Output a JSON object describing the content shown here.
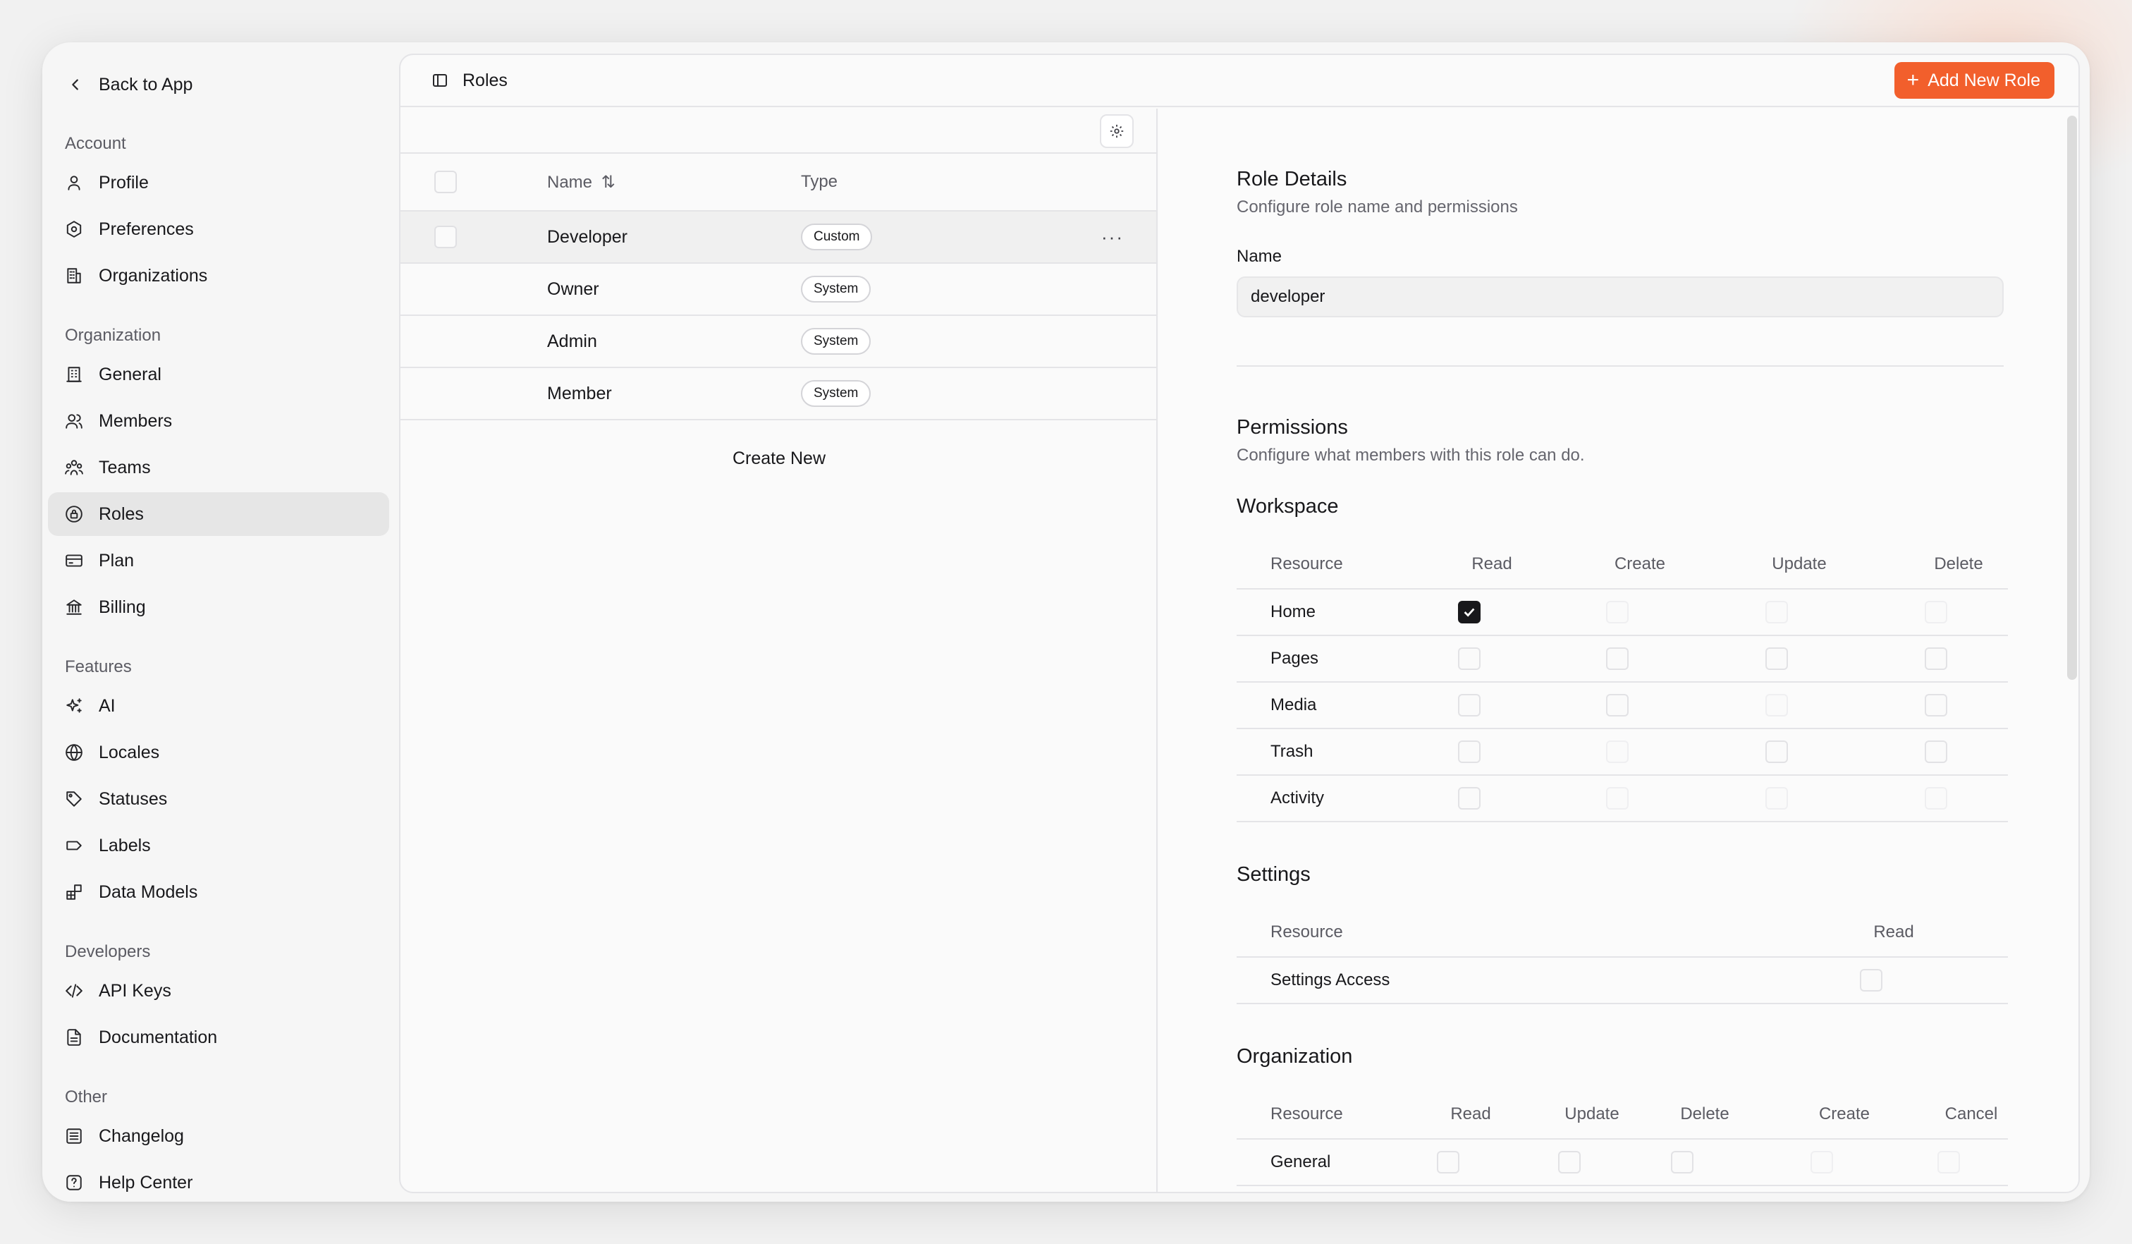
{
  "sidebar": {
    "back_label": "Back to App",
    "sections": [
      {
        "label": "Account",
        "items": [
          {
            "label": "Profile",
            "icon": "user-icon"
          },
          {
            "label": "Preferences",
            "icon": "settings-hexagon-icon"
          },
          {
            "label": "Organizations",
            "icon": "building-icon"
          }
        ]
      },
      {
        "label": "Organization",
        "items": [
          {
            "label": "General",
            "icon": "building-2-icon"
          },
          {
            "label": "Members",
            "icon": "users-icon"
          },
          {
            "label": "Teams",
            "icon": "team-icon"
          },
          {
            "label": "Roles",
            "icon": "lock-icon",
            "active": true
          },
          {
            "label": "Plan",
            "icon": "credit-card-icon"
          },
          {
            "label": "Billing",
            "icon": "bank-icon"
          }
        ]
      },
      {
        "label": "Features",
        "items": [
          {
            "label": "AI",
            "icon": "sparkles-icon"
          },
          {
            "label": "Locales",
            "icon": "globe-icon"
          },
          {
            "label": "Statuses",
            "icon": "tag-icon"
          },
          {
            "label": "Labels",
            "icon": "label-icon"
          },
          {
            "label": "Data Models",
            "icon": "blocks-icon"
          }
        ]
      },
      {
        "label": "Developers",
        "items": [
          {
            "label": "API Keys",
            "icon": "code-icon"
          },
          {
            "label": "Documentation",
            "icon": "file-icon"
          }
        ]
      },
      {
        "label": "Other",
        "items": [
          {
            "label": "Changelog",
            "icon": "list-icon"
          },
          {
            "label": "Help Center",
            "icon": "help-icon"
          }
        ]
      }
    ]
  },
  "header": {
    "title": "Roles",
    "add_button": "Add New Role"
  },
  "roles_table": {
    "columns": {
      "name": "Name",
      "type": "Type"
    },
    "rows": [
      {
        "name": "Developer",
        "type": "Custom"
      },
      {
        "name": "Owner",
        "type": "System"
      },
      {
        "name": "Admin",
        "type": "System"
      },
      {
        "name": "Member",
        "type": "System"
      }
    ],
    "create_new": "Create New"
  },
  "details": {
    "title": "Role Details",
    "subtitle": "Configure role name and permissions",
    "name_label": "Name",
    "name_value": "developer",
    "permissions_title": "Permissions",
    "permissions_subtitle": "Configure what members with this role can do.",
    "workspace": {
      "title": "Workspace",
      "resource_header": "Resource",
      "columns": [
        "Read",
        "Create",
        "Update",
        "Delete"
      ],
      "rows": [
        {
          "name": "Home",
          "checked": [
            true,
            false,
            false,
            false
          ]
        },
        {
          "name": "Pages",
          "checked": [
            false,
            false,
            false,
            false
          ]
        },
        {
          "name": "Media",
          "checked": [
            false,
            false,
            false,
            false
          ]
        },
        {
          "name": "Trash",
          "checked": [
            false,
            false,
            false,
            false
          ]
        },
        {
          "name": "Activity",
          "checked": [
            false,
            false,
            false,
            false
          ]
        }
      ]
    },
    "settings": {
      "title": "Settings",
      "resource_header": "Resource",
      "columns": [
        "Read"
      ],
      "rows": [
        {
          "name": "Settings Access",
          "checked": [
            false
          ]
        }
      ]
    },
    "organization": {
      "title": "Organization",
      "resource_header": "Resource",
      "columns": [
        "Read",
        "Update",
        "Delete",
        "Create",
        "Cancel"
      ],
      "rows": [
        {
          "name": "General",
          "checked": [
            false,
            false,
            false,
            false,
            false
          ]
        }
      ]
    }
  }
}
